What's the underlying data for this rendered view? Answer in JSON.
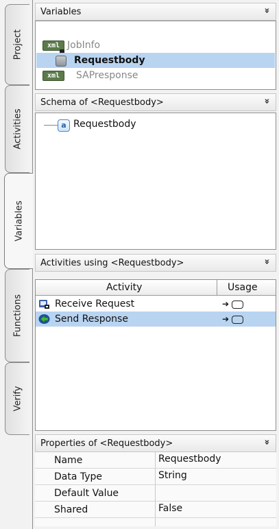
{
  "tabs": [
    {
      "label": "Project"
    },
    {
      "label": "Activities"
    },
    {
      "label": "Variables"
    },
    {
      "label": "Functions"
    },
    {
      "label": "Verify"
    }
  ],
  "active_tab": "Variables",
  "variables": {
    "title": "Variables",
    "collapse_icon": "double-chevron-down-icon",
    "items": [
      {
        "label": "JobInfo",
        "icon": "xml-locked-icon",
        "badge": "xml"
      },
      {
        "label": "Requestbody",
        "icon": "database-icon"
      },
      {
        "label": "SAPresponse",
        "icon": "xml-icon",
        "badge": "xml"
      }
    ]
  },
  "schema": {
    "title": "Schema of <Requestbody>",
    "node_icon": "attribute-icon",
    "node_icon_glyph": "a",
    "node_label": "Requestbody"
  },
  "activities": {
    "title": "Activities using <Requestbody>",
    "columns": [
      "Activity",
      "Usage"
    ],
    "rows": [
      {
        "name": "Receive Request",
        "icon": "receive-request-icon",
        "usage_icon": "arrow-into-box-icon"
      },
      {
        "name": "Send Response",
        "icon": "send-response-icon",
        "usage_icon": "arrow-into-box-icon"
      }
    ]
  },
  "properties": {
    "title": "Properties of <Requestbody>",
    "rows": [
      {
        "key": "Name",
        "value": "Requestbody"
      },
      {
        "key": "Data Type",
        "value": "String"
      },
      {
        "key": "Default Value",
        "value": ""
      },
      {
        "key": "Shared",
        "value": "False"
      }
    ]
  },
  "colors": {
    "selection": "#b8d4f1",
    "xml_badge": "#5c7a4a"
  }
}
